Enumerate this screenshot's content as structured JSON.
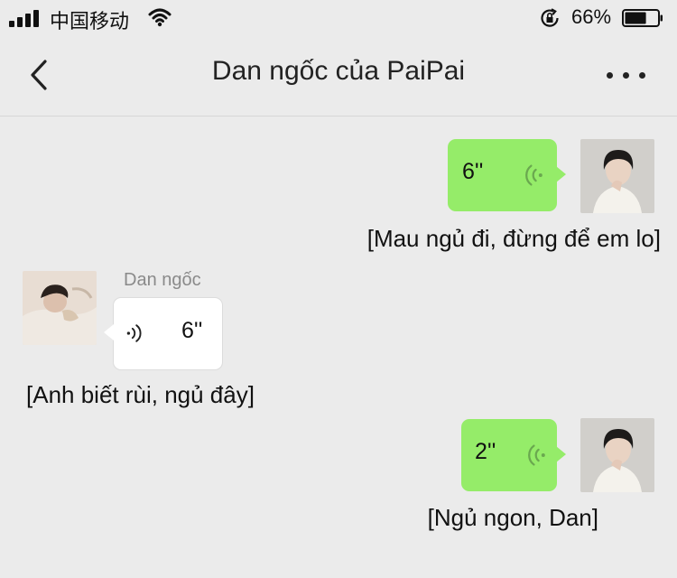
{
  "status_bar": {
    "carrier": "中国移动",
    "battery_percent": "66%",
    "battery_level": 0.66
  },
  "nav": {
    "title": "Dan ngốc của PaiPai"
  },
  "messages": [
    {
      "direction": "outgoing",
      "duration": "6''",
      "caption": "[Mau ngủ đi, đừng để em lo]"
    },
    {
      "direction": "incoming",
      "sender": "Dan ngốc",
      "duration": "6''",
      "caption": "[Anh biết rùi, ngủ đây]"
    },
    {
      "direction": "outgoing",
      "duration": "2''",
      "caption": "[Ngủ ngon, Dan]"
    }
  ],
  "colors": {
    "background": "#ebebeb",
    "outgoing_bubble": "#95ec69",
    "incoming_bubble": "#ffffff",
    "voice_icon_outgoing": "#6aa84f"
  },
  "icons": {
    "back": "chevron-left-icon",
    "more": "more-dots-icon",
    "voice": "voice-wave-icon",
    "wifi": "wifi-icon",
    "rotation_lock": "rotation-lock-icon",
    "battery": "battery-icon",
    "signal": "signal-bars-icon"
  }
}
